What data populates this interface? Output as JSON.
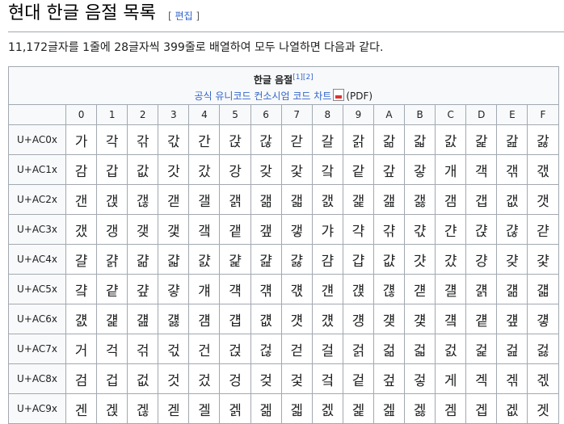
{
  "page": {
    "title": "현대 한글 음절 목록",
    "edit_open": "[ ",
    "edit_label": "편집",
    "edit_close": " ]",
    "intro": "11,172글자를 1줄에 28글자씩 399줄로 배열하여 모두 나열하면 다음과 같다."
  },
  "table": {
    "caption_title": "한글 음절",
    "refs": "[1][2]",
    "chart_link": "공식 유니코드 컨소시엄 코드 차트",
    "pdf_icon": "pdf-icon",
    "pdf_suffix": "(PDF)",
    "columns": [
      "0",
      "1",
      "2",
      "3",
      "4",
      "5",
      "6",
      "7",
      "8",
      "9",
      "A",
      "B",
      "C",
      "D",
      "E",
      "F"
    ],
    "rows": [
      {
        "label": "U+AC0x",
        "cells": [
          "가",
          "각",
          "갂",
          "갃",
          "간",
          "갅",
          "갆",
          "갇",
          "갈",
          "갉",
          "갊",
          "갋",
          "갌",
          "갍",
          "갎",
          "갏"
        ]
      },
      {
        "label": "U+AC1x",
        "cells": [
          "감",
          "갑",
          "값",
          "갓",
          "갔",
          "강",
          "갖",
          "갗",
          "갘",
          "같",
          "갚",
          "갛",
          "개",
          "객",
          "갞",
          "갟"
        ]
      },
      {
        "label": "U+AC2x",
        "cells": [
          "갠",
          "갡",
          "갢",
          "갣",
          "갤",
          "갥",
          "갦",
          "갧",
          "갨",
          "갩",
          "갪",
          "갫",
          "갬",
          "갭",
          "갮",
          "갯"
        ]
      },
      {
        "label": "U+AC3x",
        "cells": [
          "갰",
          "갱",
          "갲",
          "갳",
          "갴",
          "갵",
          "갶",
          "갷",
          "갸",
          "갹",
          "갺",
          "갻",
          "갼",
          "갽",
          "갾",
          "갿"
        ]
      },
      {
        "label": "U+AC4x",
        "cells": [
          "걀",
          "걁",
          "걂",
          "걃",
          "걄",
          "걅",
          "걆",
          "걇",
          "걈",
          "걉",
          "걊",
          "걋",
          "걌",
          "걍",
          "걎",
          "걏"
        ]
      },
      {
        "label": "U+AC5x",
        "cells": [
          "걐",
          "걑",
          "걒",
          "걓",
          "걔",
          "걕",
          "걖",
          "걗",
          "걘",
          "걙",
          "걚",
          "걛",
          "걜",
          "걝",
          "걞",
          "걟"
        ]
      },
      {
        "label": "U+AC6x",
        "cells": [
          "걠",
          "걡",
          "걢",
          "걣",
          "걤",
          "걥",
          "걦",
          "걧",
          "걨",
          "걩",
          "걪",
          "걫",
          "걬",
          "걭",
          "걮",
          "걯"
        ]
      },
      {
        "label": "U+AC7x",
        "cells": [
          "거",
          "걱",
          "걲",
          "걳",
          "건",
          "걵",
          "걶",
          "걷",
          "걸",
          "걹",
          "걺",
          "걻",
          "걼",
          "걽",
          "걾",
          "걿"
        ]
      },
      {
        "label": "U+AC8x",
        "cells": [
          "검",
          "겁",
          "겂",
          "것",
          "겄",
          "겅",
          "겆",
          "겇",
          "겈",
          "겉",
          "겊",
          "겋",
          "게",
          "겍",
          "겎",
          "겏"
        ]
      },
      {
        "label": "U+AC9x",
        "cells": [
          "겐",
          "겑",
          "겒",
          "겓",
          "겔",
          "겕",
          "겖",
          "겗",
          "겘",
          "겙",
          "겚",
          "겛",
          "겜",
          "겝",
          "겞",
          "겟"
        ]
      }
    ]
  }
}
